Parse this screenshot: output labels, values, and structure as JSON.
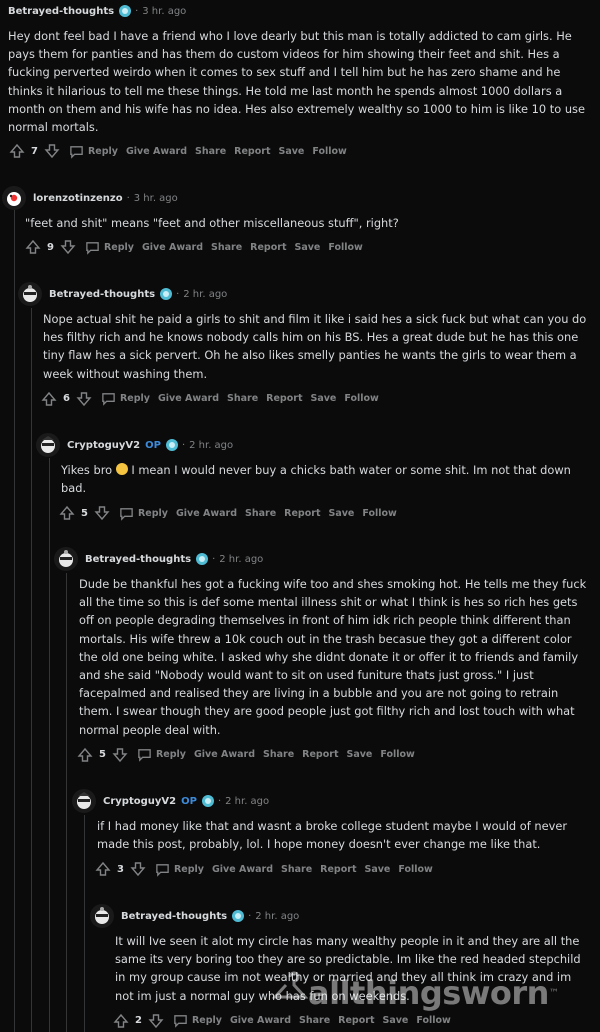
{
  "comments": [
    {
      "user": "Betrayed-thoughts",
      "op": "",
      "time": "3 hr. ago",
      "body": "Hey dont feel bad I have a friend who I love dearly but this man is totally addicted to cam girls. He pays them for panties and has them do custom videos for him showing their feet and shit. Hes a fucking perverted weirdo when it comes to sex stuff and I tell him but he has zero shame and he thinks it hilarious to tell me these things. He told me last month he spends almost 1000 dollars a month on them and his wife has no idea. Hes also extremely wealthy so 1000 to him is like 10 to use normal mortals.",
      "score": "7"
    },
    {
      "user": "lorenzotinzenzo",
      "op": "",
      "time": "3 hr. ago",
      "body": "\"feet and shit\" means \"feet and other miscellaneous stuff\", right?",
      "score": "9"
    },
    {
      "user": "Betrayed-thoughts",
      "op": "",
      "time": "2 hr. ago",
      "body": "Nope actual shit he paid a girls to shit and film it like i said hes a sick fuck but what can you do hes filthy rich and he knows nobody calls him on his BS. Hes a great dude but he has this one tiny flaw hes a sick pervert. Oh he also likes smelly panties he wants the girls to wear them a week without washing them.",
      "score": "6"
    },
    {
      "user": "CryptoguyV2",
      "op": "OP",
      "time": "2 hr. ago",
      "body_before": "Yikes bro ",
      "body_after": " I mean I would never buy a chicks bath water or some shit. Im not that down bad.",
      "score": "5"
    },
    {
      "user": "Betrayed-thoughts",
      "op": "",
      "time": "2 hr. ago",
      "body": "Dude be thankful hes got a fucking wife too and shes smoking hot. He tells me they fuck all the time so this is def some mental illness shit or what I think is hes so rich hes gets off on people degrading themselves in front of him idk rich people think different than mortals. His wife threw a 10k couch out in the trash becasue they got a different color the old one being white. I asked why she didnt donate it or offer it to friends and family and she said \"Nobody would want to sit on used funiture thats just gross.\" I just facepalmed and realised they are living in a bubble and you are not going to retrain them. I swear though they are good people just got filthy rich and lost touch with what normal people deal with.",
      "score": "5"
    },
    {
      "user": "CryptoguyV2",
      "op": "OP",
      "time": "2 hr. ago",
      "body": "if I had money like that and wasnt a broke college student maybe I would of never made this post, probably, lol. I hope money doesn't ever change me like that.",
      "score": "3"
    },
    {
      "user": "Betrayed-thoughts",
      "op": "",
      "time": "2 hr. ago",
      "body": "It will Ive seen it alot my circle has many wealthy people in it and they are all the same its very boring too they are so predictable. Im like the red headed stepchild in my group cause im not wealthy or married and they all think im crazy and im not im just a normal guy who has fun on weekends.",
      "score": "2"
    }
  ],
  "actions": {
    "reply": "Reply",
    "give_award": "Give Award",
    "share": "Share",
    "report": "Report",
    "save": "Save",
    "follow": "Follow"
  },
  "watermark": {
    "brand": "allthingsworn",
    "tm": "™"
  },
  "colors": {
    "background": "#0b0b0c",
    "op_badge": "#3d8bd9",
    "muted": "#818384"
  }
}
